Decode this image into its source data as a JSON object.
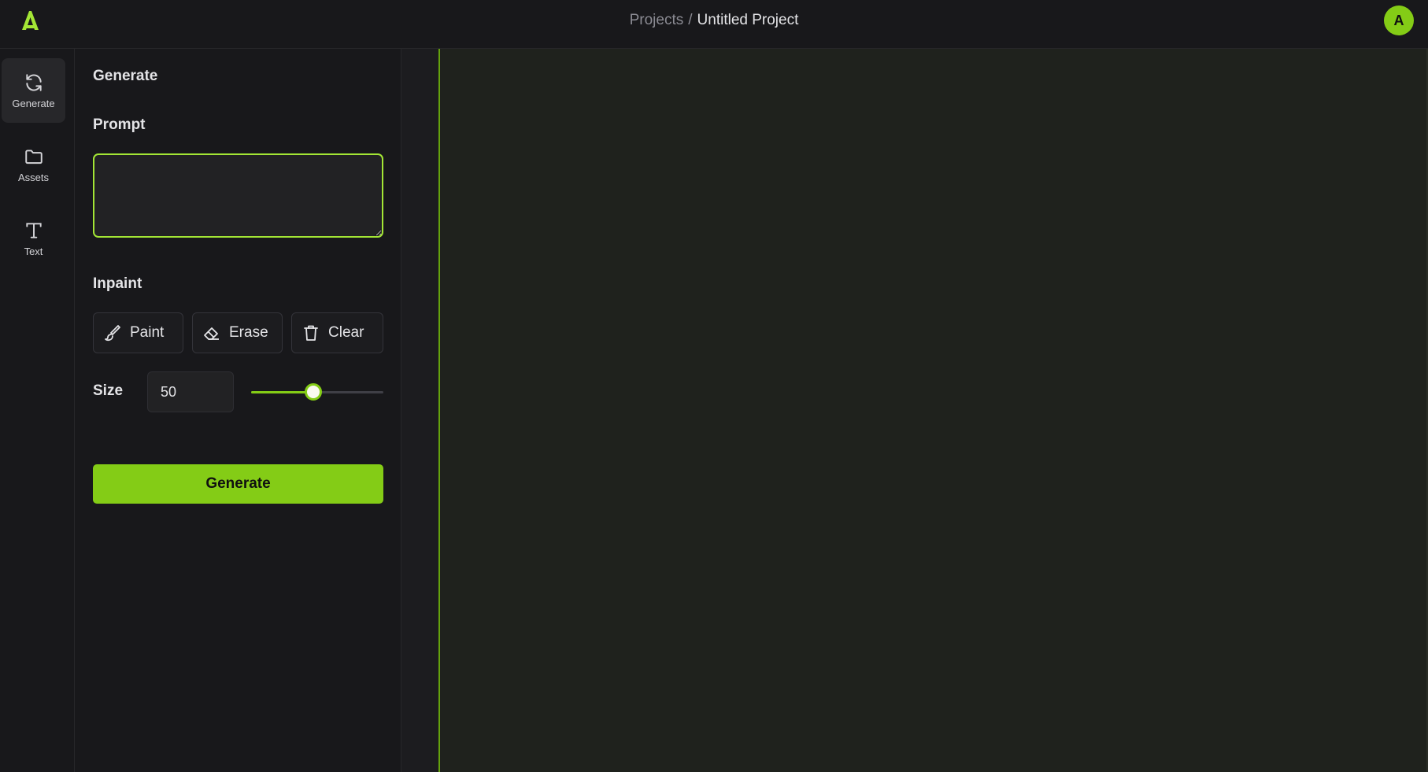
{
  "header": {
    "breadcrumb_root": "Projects",
    "breadcrumb_separator": "/",
    "project_name": "Untitled Project",
    "avatar_initial": "A",
    "logo_icon": "brand-logo-icon"
  },
  "rail": {
    "items": [
      {
        "label": "Generate",
        "icon": "refresh-icon",
        "active": true
      },
      {
        "label": "Assets",
        "icon": "folder-icon",
        "active": false
      },
      {
        "label": "Text",
        "icon": "text-icon",
        "active": false
      }
    ]
  },
  "panel": {
    "title": "Generate",
    "prompt_label": "Prompt",
    "prompt_value": "",
    "prompt_placeholder": "",
    "inpaint_label": "Inpaint",
    "tools": {
      "paint": "Paint",
      "erase": "Erase",
      "clear": "Clear"
    },
    "size_label": "Size",
    "size_value": "50",
    "size_slider_fraction": 0.47,
    "generate_label": "Generate"
  },
  "colors": {
    "accent": "#84cc16",
    "background": "#18181b",
    "canvas": "#1f221d"
  }
}
